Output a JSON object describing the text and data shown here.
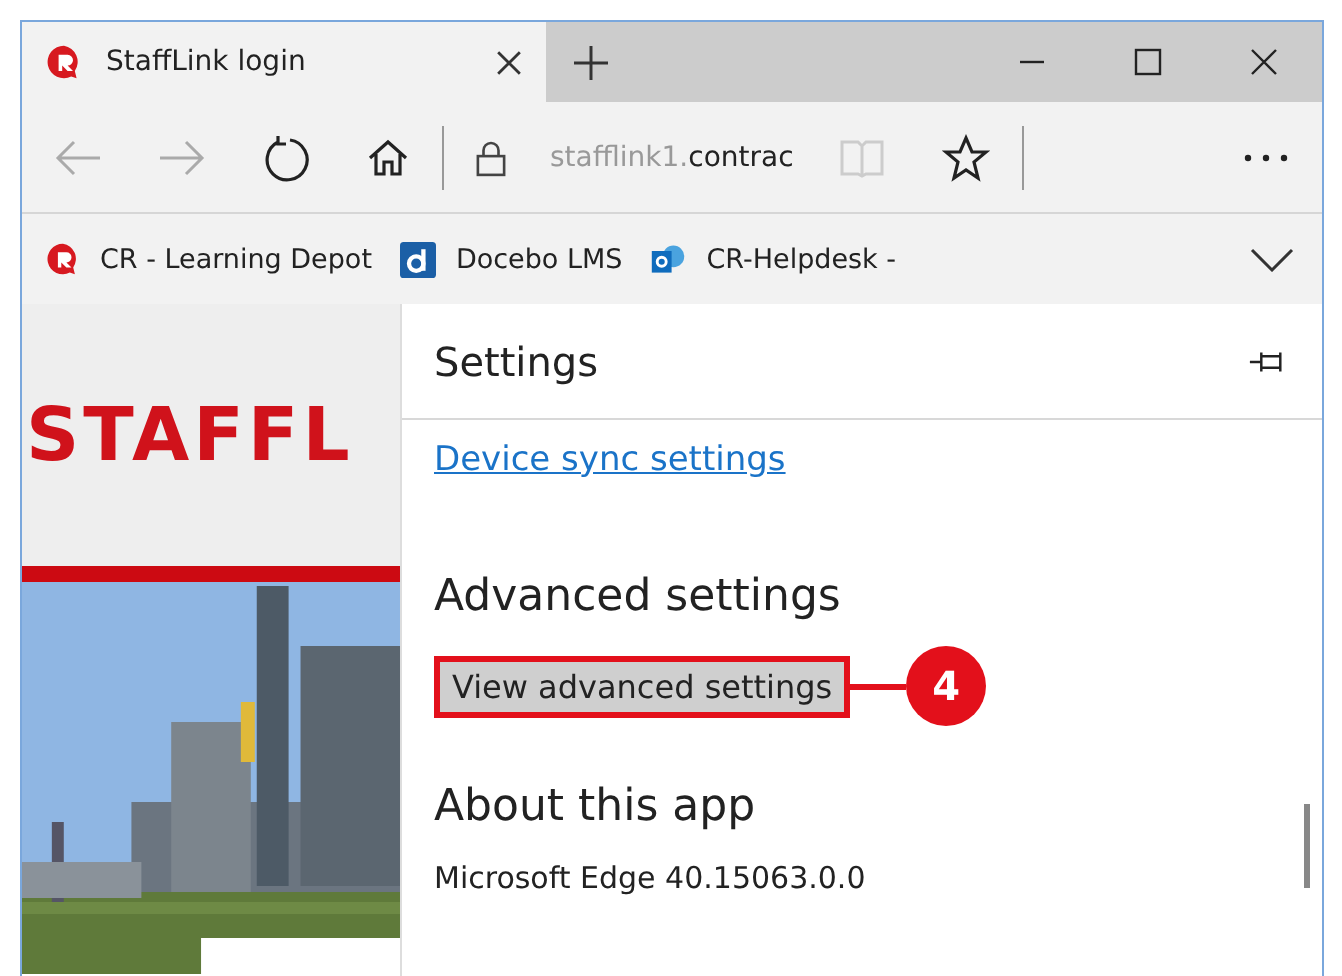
{
  "tab": {
    "title": "StaffLink login",
    "selected": true
  },
  "address": {
    "subdomain": "stafflink1.",
    "domain": "contrac"
  },
  "favorites": [
    {
      "label": "CR - Learning Depot",
      "kind": "cr"
    },
    {
      "label": "Docebo LMS",
      "kind": "docebo"
    },
    {
      "label": "CR-Helpdesk -",
      "kind": "sharepoint"
    }
  ],
  "page": {
    "logo": "STAFFL"
  },
  "settings": {
    "title": "Settings",
    "link": "Device sync settings",
    "advanced_heading": "Advanced settings",
    "advanced_button": {
      "label": "View advanced settings",
      "highlighted": true
    },
    "about_heading": "About this app",
    "version": "Microsoft Edge 40.15063.0.0"
  },
  "callout": {
    "label": "4"
  }
}
